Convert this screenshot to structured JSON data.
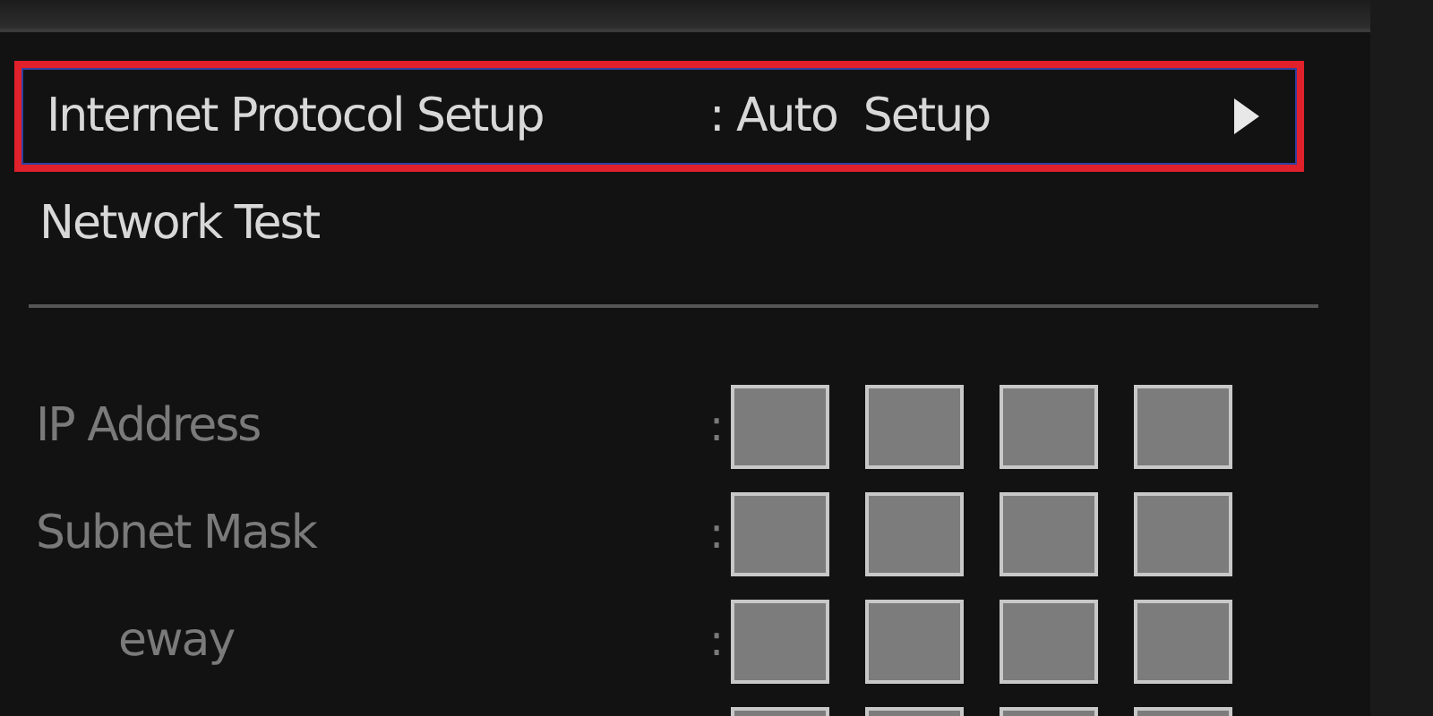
{
  "menu": {
    "items": [
      {
        "label": "Internet Protocol Setup",
        "value": ": Auto  Setup",
        "selected": true
      },
      {
        "label": "Network Test",
        "selected": false
      }
    ]
  },
  "address_rows": [
    {
      "label": "IP Address",
      "separator": ":",
      "disabled": true
    },
    {
      "label": "Subnet Mask",
      "separator": ":",
      "disabled": true
    },
    {
      "label": "eway",
      "separator": ":",
      "disabled": true
    },
    {}
  ]
}
